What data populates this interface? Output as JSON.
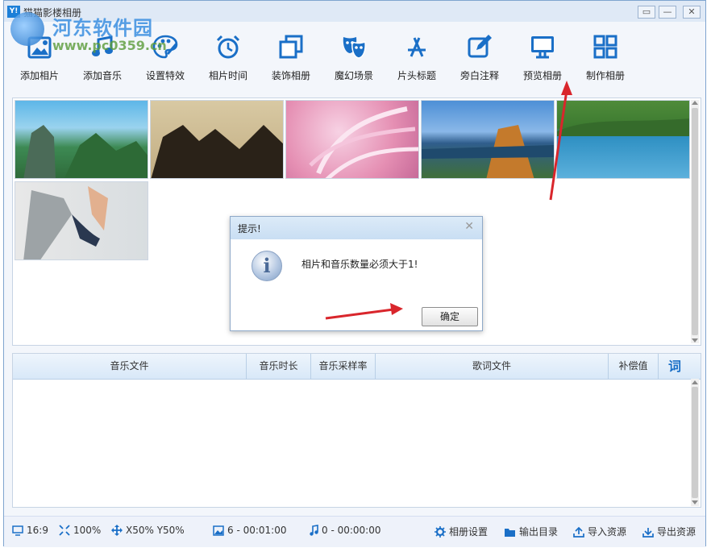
{
  "window": {
    "title": "猫猫影楼相册",
    "app_icon_text": "Y!",
    "minimize_label": "—",
    "restore_label": "▭",
    "close_label": "✕"
  },
  "watermark": {
    "cn": "河东软件园",
    "url": "www.pc0359.cn"
  },
  "toolbar": {
    "items": [
      {
        "label": "添加相片",
        "icon": "add-photo-icon"
      },
      {
        "label": "添加音乐",
        "icon": "music-note-icon"
      },
      {
        "label": "设置特效",
        "icon": "palette-icon"
      },
      {
        "label": "相片时间",
        "icon": "alarm-clock-icon"
      },
      {
        "label": "装饰相册",
        "icon": "stacked-frames-icon"
      },
      {
        "label": "魔幻场景",
        "icon": "theater-masks-icon"
      },
      {
        "label": "片头标题",
        "icon": "app-store-a-icon"
      },
      {
        "label": "旁白注释",
        "icon": "edit-pencil-icon"
      },
      {
        "label": "预览相册",
        "icon": "monitor-icon"
      },
      {
        "label": "制作相册",
        "icon": "grid-icon"
      }
    ]
  },
  "photos": {
    "count": 6,
    "items": [
      {
        "subject": "karst mountains under blue sky"
      },
      {
        "subject": "sepia ink-wash mountains"
      },
      {
        "subject": "pink feather wings"
      },
      {
        "subject": "lake with autumn trees"
      },
      {
        "subject": "mountain lake"
      },
      {
        "subject": "woman in denim shorts"
      }
    ]
  },
  "music_table": {
    "columns": [
      "音乐文件",
      "音乐时长",
      "音乐采样率",
      "歌词文件",
      "补偿值",
      "词"
    ]
  },
  "statusbar": {
    "aspect": "16:9",
    "zoom": "100%",
    "position": "X50% Y50%",
    "photo_info": "6 - 00:01:00",
    "music_info": "0 - 00:00:00",
    "album_settings": "相册设置",
    "output_dir": "输出目录",
    "import_res": "导入资源",
    "export_res": "导出资源"
  },
  "dialog": {
    "title": "提示!",
    "message": "相片和音乐数量必须大于1!",
    "ok_label": "确定",
    "close_label": "✕"
  },
  "colors": {
    "accent": "#1c7fd8",
    "annotation_arrow": "#d9262c",
    "icon_blue": "#1a6fc7"
  }
}
